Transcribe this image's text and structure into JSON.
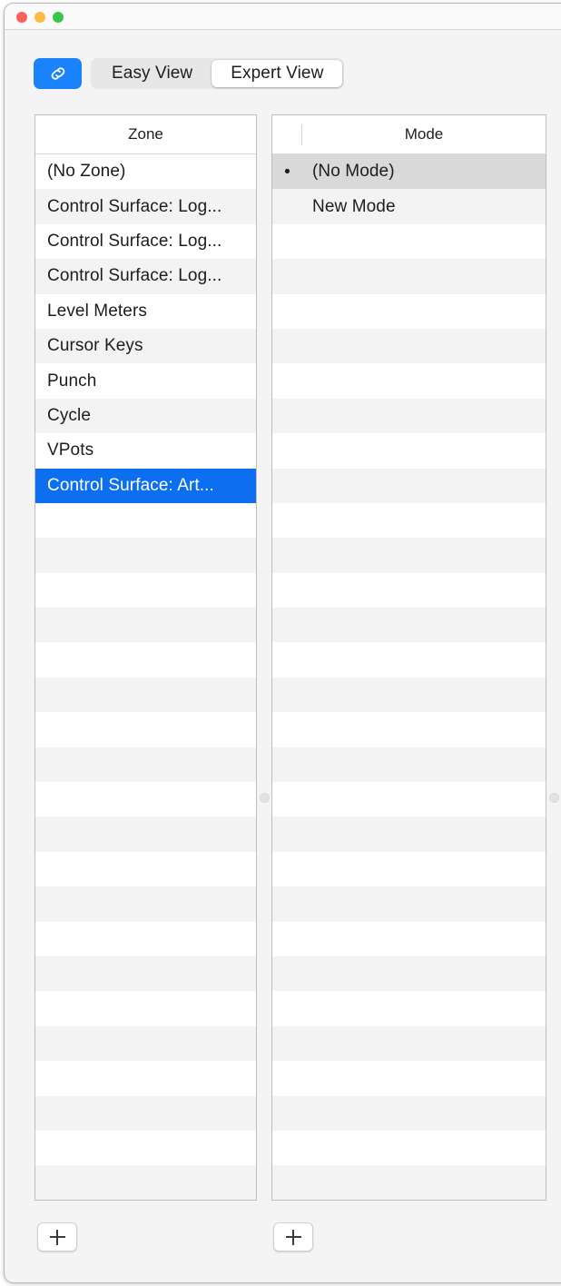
{
  "window": {
    "traffic_lights": [
      {
        "name": "close",
        "color": "#fc6058"
      },
      {
        "name": "minimize",
        "color": "#fdbc40"
      },
      {
        "name": "zoom",
        "color": "#34c748"
      }
    ]
  },
  "toolbar": {
    "link_button": {
      "icon": "link-icon",
      "active": true,
      "color": "#1a82fb"
    },
    "view_segments": [
      {
        "label": "Easy View",
        "selected": false
      },
      {
        "label": "Expert View",
        "selected": true
      }
    ]
  },
  "zone_pane": {
    "header": "Zone",
    "rows": [
      {
        "label": "(No Zone)",
        "marker": "",
        "state": "normal"
      },
      {
        "label": "Control Surface: Log...",
        "marker": "",
        "state": "normal"
      },
      {
        "label": "Control Surface: Log...",
        "marker": "",
        "state": "normal"
      },
      {
        "label": "Control Surface: Log...",
        "marker": "",
        "state": "normal"
      },
      {
        "label": "Level Meters",
        "marker": "",
        "state": "normal"
      },
      {
        "label": "Cursor Keys",
        "marker": "",
        "state": "normal"
      },
      {
        "label": "Punch",
        "marker": "",
        "state": "normal"
      },
      {
        "label": "Cycle",
        "marker": "",
        "state": "normal"
      },
      {
        "label": "VPots",
        "marker": "",
        "state": "normal"
      },
      {
        "label": "Control Surface: Art...",
        "marker": "",
        "state": "selected-active"
      }
    ],
    "empty_row_count": 21,
    "add_button": {
      "label": "+",
      "icon": "plus-icon"
    }
  },
  "mode_pane": {
    "header": "Mode",
    "has_marker_column": true,
    "rows": [
      {
        "label": "(No Mode)",
        "marker": "•",
        "state": "selected-inactive"
      },
      {
        "label": "New Mode",
        "marker": "",
        "state": "normal"
      }
    ],
    "empty_row_count": 29,
    "add_button": {
      "label": "+",
      "icon": "plus-icon"
    }
  },
  "splitters": [
    {
      "name": "splitter-grip-middle"
    },
    {
      "name": "splitter-grip-right"
    }
  ],
  "colors": {
    "selection_active": "#0b6ff0",
    "selection_inactive": "#d9d9d9",
    "row_stripe": "#f3f3f3",
    "accent": "#1a82fb",
    "window_bg": "#f4f4f4"
  }
}
